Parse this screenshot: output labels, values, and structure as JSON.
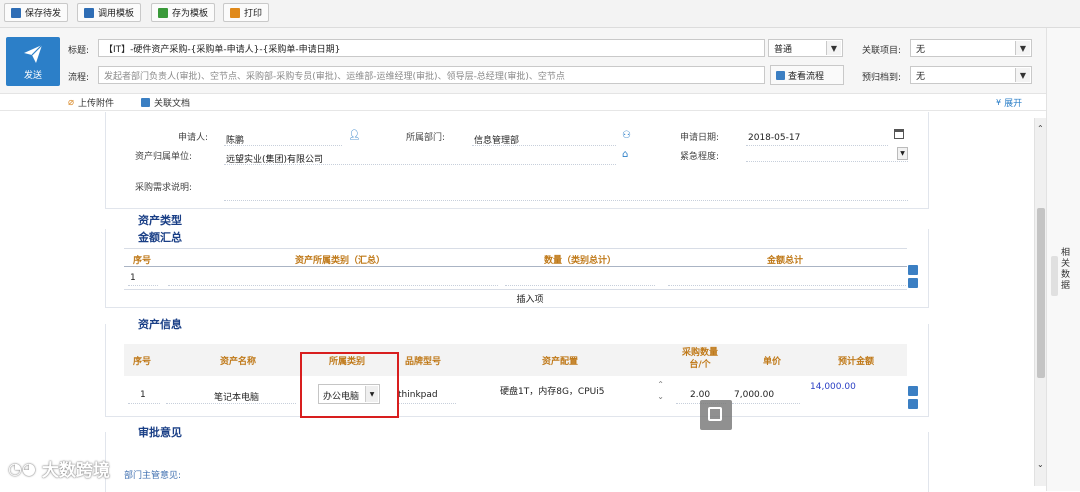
{
  "toolbar": {
    "buttons": [
      {
        "label": "保存待发",
        "color": "#2e6db5"
      },
      {
        "label": "调用模板",
        "color": "#2e6db5"
      },
      {
        "label": "存为模板",
        "color": "#3a9a3a"
      },
      {
        "label": "打印",
        "color": "#e08a1c"
      }
    ]
  },
  "header": {
    "send_label": "发送",
    "title_label": "标题:",
    "title_value": "【IT】-硬件资产采购-{采购单-申请人}-{采购单-申请日期}",
    "priority_value": "普通",
    "process_label": "流程:",
    "process_value": "发起者部门负责人(审批)、空节点、采购部-采购专员(审批)、运维部-运维经理(审批)、领导层-总经理(审批)、空节点",
    "view_flow_label": "查看流程",
    "related_project_label": "关联项目:",
    "related_project_value": "无",
    "archive_label": "预归档到:",
    "archive_value": "无",
    "attach_label": "上传附件",
    "related_doc_label": "关联文档",
    "expand_label": "展开"
  },
  "form": {
    "applicant_label": "申请人:",
    "applicant_value": "陈鹏",
    "dept_label": "所属部门:",
    "dept_value": "信息管理部",
    "date_label": "申请日期:",
    "date_value": "2018-05-17",
    "unit_label": "资产归属单位:",
    "unit_value": "远望实业(集团)有限公司",
    "urgency_label": "紧急程度:",
    "urgency_value": "",
    "desc_label": "采购需求说明:"
  },
  "summary": {
    "title_line1": "资产类型",
    "title_line2": "金额汇总",
    "headers": [
      "序号",
      "资产所属类别（汇总）",
      "数量（类别总计）",
      "金额总计"
    ],
    "row": {
      "no": "1"
    },
    "insert_label": "插入项"
  },
  "asset": {
    "title": "资产信息",
    "headers": [
      "序号",
      "资产名称",
      "所属类别",
      "品牌型号",
      "资产配置",
      "采购数量台/个",
      "单价",
      "预计金额"
    ],
    "row": {
      "no": "1",
      "name": "笔记本电脑",
      "category": "办公电脑",
      "brand": "thinkpad",
      "config": "硬盘1T，内存8G，CPUi5",
      "qty": "2.00",
      "price": "7,000.00",
      "total": "14,000.00"
    }
  },
  "approval": {
    "title": "审批意见",
    "dept_head_label": "部门主管意见:"
  },
  "side_panel_label": "相关数据",
  "watermark": "大数跨境",
  "colors": {
    "accent": "#2c7fc8",
    "section": "#1a3f86",
    "header_text": "#c07a1a",
    "highlight_box": "#d81e1e"
  }
}
